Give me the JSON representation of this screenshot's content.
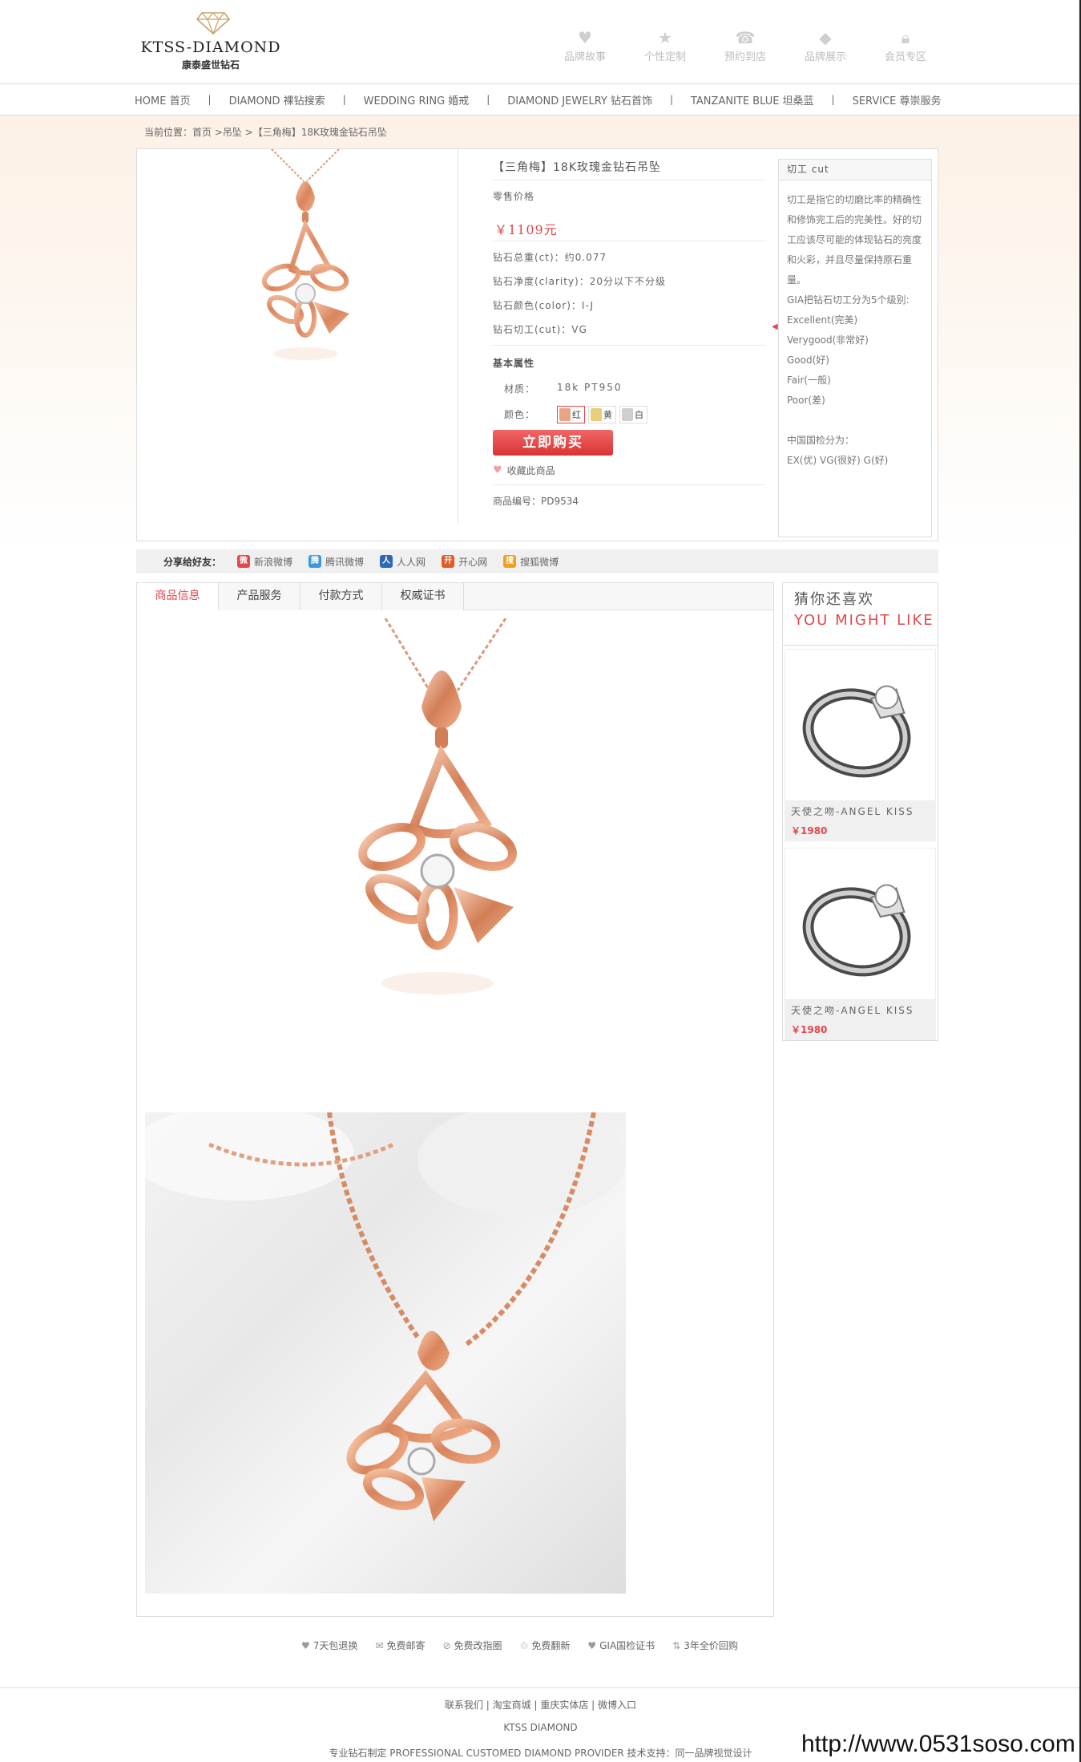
{
  "header": {
    "logo_en": "KTSS-DIAMOND",
    "logo_cn": "康泰盛世钻石",
    "icons": [
      {
        "label": "品牌故事",
        "icon": "heart-icon"
      },
      {
        "label": "个性定制",
        "icon": "star-icon"
      },
      {
        "label": "预约到店",
        "icon": "phone-icon"
      },
      {
        "label": "品牌展示",
        "icon": "diamond-icon"
      },
      {
        "label": "会员专区",
        "icon": "lock-icon"
      }
    ]
  },
  "nav": {
    "items": [
      "HOME 首页",
      "DIAMOND 裸钻搜索",
      "WEDDING RING 婚戒",
      "DIAMOND JEWELRY 钻石首饰",
      "TANZANITE BLUE 坦桑蓝",
      "SERVICE 尊崇服务"
    ],
    "separator": "|"
  },
  "breadcrumb": "当前位置：首页 >吊坠 >【三角梅】18K玫瑰金钻石吊坠",
  "product": {
    "title": "【三角梅】18K玫瑰金钻石吊坠",
    "price_label": "零售价格",
    "price": "￥1109元",
    "specs": [
      "钻石总重(ct)：约0.077",
      "钻石净度(clarity)：20分以下不分级",
      "钻石颜色(color)：I-J",
      "钻石切工(cut)：VG"
    ],
    "basic_attrs_heading": "基本属性",
    "material_label": "材质：",
    "material_value": "18k PT950",
    "color_label": "颜色：",
    "colors": [
      {
        "label": "红",
        "swatch": "#e8a486",
        "selected": true
      },
      {
        "label": "黄",
        "swatch": "#e8cd7a",
        "selected": false
      },
      {
        "label": "白",
        "swatch": "#cfcfcf",
        "selected": false
      }
    ],
    "buy_label": "立即购买",
    "fav_label": "收藏此商品",
    "code": "商品编号：PD9534"
  },
  "cut_panel": {
    "heading": "切工 cut",
    "lines": [
      "切工是指它的切磨比率的精确性",
      "和修饰完工后的完美性。好的切",
      "工应该尽可能的体现钻石的亮度",
      "和火彩，并且尽量保持原石重",
      "量。",
      "GIA把钻石切工分为5个级别:",
      "Excellent(完美)",
      "Verygood(非常好)",
      "Good(好)",
      "Fair(一般)",
      "Poor(差)",
      "",
      "中国国检分为：",
      "EX(优)  VG(很好)  G(好)"
    ]
  },
  "share": {
    "title": "分享给好友：",
    "items": [
      {
        "label": "新浪微博",
        "color": "#e0484e",
        "glyph": "微"
      },
      {
        "label": "腾讯微博",
        "color": "#3c9ad9",
        "glyph": "腾"
      },
      {
        "label": "人人网",
        "color": "#2a68b8",
        "glyph": "人"
      },
      {
        "label": "开心网",
        "color": "#e05a2a",
        "glyph": "开"
      },
      {
        "label": "搜狐微博",
        "color": "#f0a020",
        "glyph": "搜"
      }
    ]
  },
  "tabs": [
    "商品信息",
    "产品服务",
    "付款方式",
    "权威证书"
  ],
  "recommend": {
    "title_cn": "猜你还喜欢",
    "title_en": "YOU MIGHT LIKE",
    "items": [
      {
        "name": "天使之吻-ANGEL KISS",
        "price": "￥1980"
      },
      {
        "name": "天使之吻-ANGEL KISS",
        "price": "￥1980"
      }
    ]
  },
  "services": [
    {
      "label": "7天包退换",
      "icon": "heart-icon"
    },
    {
      "label": "免费邮寄",
      "icon": "mail-icon"
    },
    {
      "label": "免费改指圈",
      "icon": "ring-icon"
    },
    {
      "label": "免费翻新",
      "icon": "refresh-icon"
    },
    {
      "label": "GIA国检证书",
      "icon": "certificate-icon"
    },
    {
      "label": "3年全价回购",
      "icon": "exchange-icon"
    }
  ],
  "footer": {
    "links": "联系我们 | 淘宝商城 | 重庆实体店 | 微博入口",
    "brand": "KTSS DIAMOND",
    "credits": "专业钻石制定 PROFESSIONAL CUSTOMED DIAMOND PROVIDER 技术支持：同一品牌视觉设计"
  },
  "watermark": "http://www.0531soso.com"
}
